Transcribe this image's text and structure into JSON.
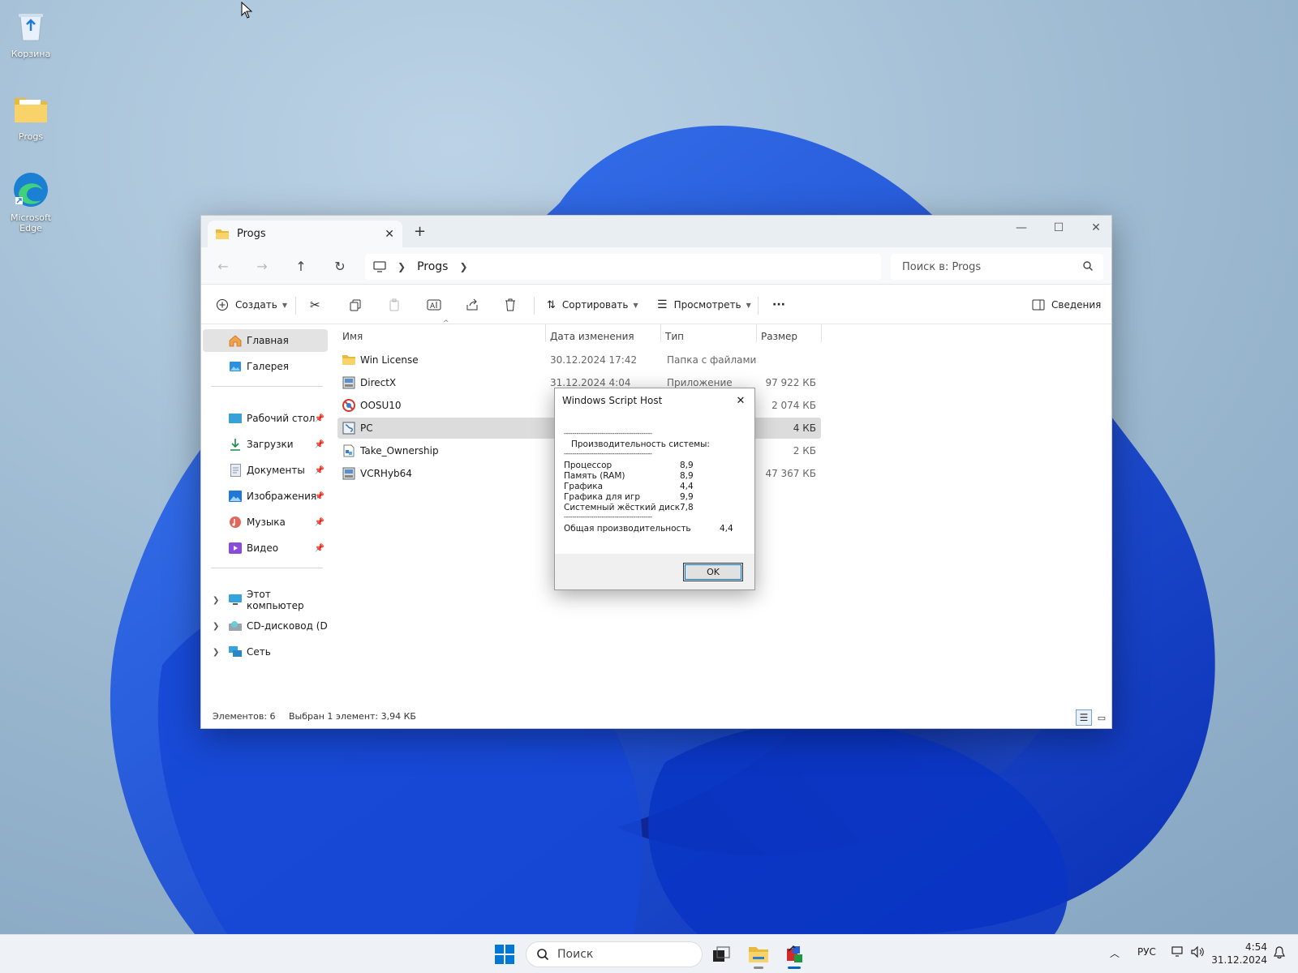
{
  "desktop": {
    "icons": [
      {
        "label": "Корзина"
      },
      {
        "label": "Progs"
      },
      {
        "label_line1": "Microsoft",
        "label_line2": "Edge"
      }
    ]
  },
  "explorer": {
    "tab_title": "Progs",
    "breadcrumb": [
      "Progs"
    ],
    "search_placeholder": "Поиск в: Progs",
    "toolbar": {
      "create": "Создать",
      "sort": "Сортировать",
      "view": "Просмотреть",
      "more": "···",
      "details": "Сведения"
    },
    "sidebar": {
      "top": [
        {
          "label": "Главная",
          "icon": "home-icon"
        },
        {
          "label": "Галерея",
          "icon": "gallery-icon"
        }
      ],
      "pinned": [
        {
          "label": "Рабочий стол",
          "icon": "desktop-icon"
        },
        {
          "label": "Загрузки",
          "icon": "downloads-icon"
        },
        {
          "label": "Документы",
          "icon": "documents-icon"
        },
        {
          "label": "Изображения",
          "icon": "pictures-icon"
        },
        {
          "label": "Музыка",
          "icon": "music-icon"
        },
        {
          "label": "Видео",
          "icon": "video-icon"
        }
      ],
      "drives": [
        {
          "label": "Этот компьютер",
          "icon": "computer-icon"
        },
        {
          "label": "CD-дисковод (D:) \\",
          "icon": "cd-drive-icon"
        },
        {
          "label": "Сеть",
          "icon": "network-icon"
        }
      ]
    },
    "columns": {
      "name": "Имя",
      "date": "Дата изменения",
      "type": "Тип",
      "size": "Размер"
    },
    "files": [
      {
        "name": "Win License",
        "date": "30.12.2024 17:42",
        "type": "Папка с файлами",
        "size": "",
        "icon": "folder-icon"
      },
      {
        "name": "DirectX",
        "date": "31.12.2024 4:04",
        "type": "Приложение",
        "size": "97 922 КБ",
        "icon": "installer-icon"
      },
      {
        "name": "OOSU10",
        "date": "",
        "type": "",
        "size": "2 074 КБ",
        "icon": "oosu-icon"
      },
      {
        "name": "PC",
        "date": "",
        "type": "",
        "size": "4 КБ",
        "icon": "script-icon",
        "selected": true
      },
      {
        "name": "Take_Ownership",
        "date": "",
        "type": "",
        "size": "2 КБ",
        "icon": "registry-icon"
      },
      {
        "name": "VCRHyb64",
        "date": "",
        "type": "",
        "size": "47 367 КБ",
        "icon": "installer-icon"
      }
    ],
    "status": {
      "count": "Элементов: 6",
      "selection": "Выбран 1 элемент: 3,94 КБ"
    }
  },
  "dialog": {
    "title": "Windows Script Host",
    "divider": "------------------------------------------",
    "heading": "Производительность системы:",
    "metrics": [
      {
        "label": "Процессор",
        "value": "8,9"
      },
      {
        "label": "Память (RAM)",
        "value": "8,9"
      },
      {
        "label": "Графика",
        "value": "4,4"
      },
      {
        "label": "Графика для игр",
        "value": "9,9"
      },
      {
        "label": "Системный жёсткий диск",
        "value": "7,8"
      }
    ],
    "total_label": "Общая производительность",
    "total_value": "4,4",
    "ok": "OK"
  },
  "taskbar": {
    "search": "Поиск",
    "lang": "РУС",
    "time": "4:54",
    "date": "31.12.2024"
  },
  "colors": {
    "accent": "#0067c0",
    "folder": "#f4c542",
    "selection": "#dcdcdc"
  }
}
